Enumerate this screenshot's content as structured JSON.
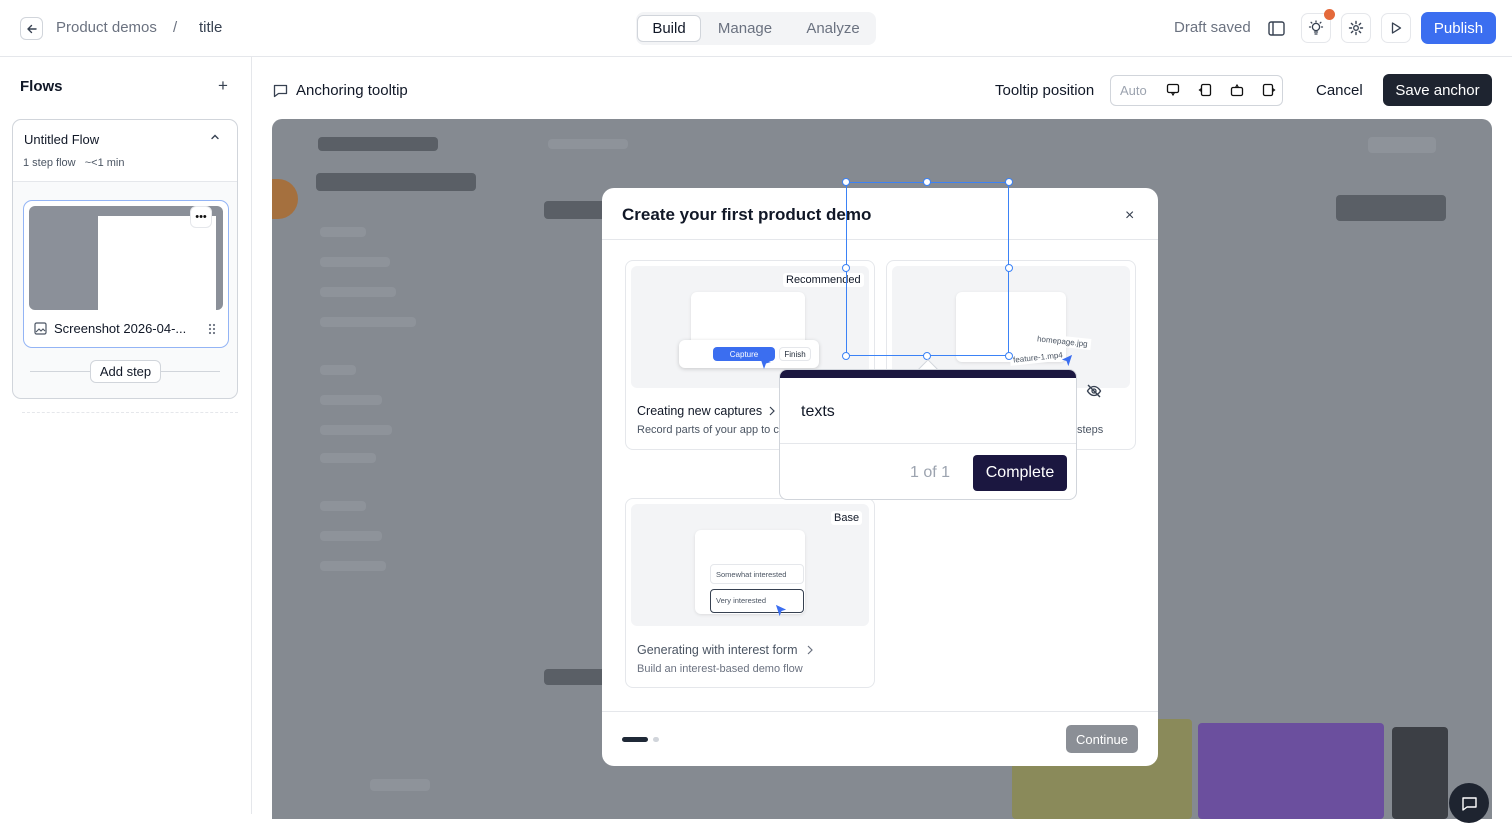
{
  "header": {
    "breadcrumb_parent": "Product demos",
    "breadcrumb_sep": "/",
    "breadcrumb_current": "title",
    "tabs": [
      {
        "label": "Build",
        "active": true
      },
      {
        "label": "Manage",
        "active": false
      },
      {
        "label": "Analyze",
        "active": false
      }
    ],
    "status": "Draft saved",
    "publish_label": "Publish",
    "icons": [
      "sidebar-toggle-icon",
      "lightbulb-icon",
      "gear-icon",
      "play-icon"
    ],
    "notification_dot_color": "#e4693a",
    "accent": "#3b6ef0"
  },
  "sidebar": {
    "title": "Flows",
    "add_label": "+",
    "flow": {
      "name": "Untitled Flow",
      "meta": "1 step flow   ~<1 min",
      "step_label": "Screenshot 2026-04-...",
      "more_label": "•••"
    },
    "add_step_label": "Add step"
  },
  "toolbar": {
    "mode_title": "Anchoring tooltip",
    "position_label": "Tooltip position",
    "position_auto": "Auto",
    "cancel_label": "Cancel",
    "save_label": "Save anchor"
  },
  "modal": {
    "title": "Create your first product demo",
    "close_label": "×",
    "options": [
      {
        "badge": "Recommended",
        "title": "Creating new captures",
        "desc": "Record parts of your app to cr",
        "capture_label": "Capture",
        "finish_label": "Finish"
      },
      {
        "desc_suffix": "steps",
        "file1": "homepage.jpg",
        "file2": "feature-1.mp4"
      },
      {
        "badge": "Base",
        "title": "Generating with interest form",
        "desc": "Build an interest-based demo flow",
        "choice1": "Somewhat interested",
        "choice2": "Very interested"
      }
    ],
    "continue_label": "Continue"
  },
  "tooltip": {
    "text": "texts",
    "count": "1 of 1",
    "complete_label": "Complete",
    "bar_color": "#1b1740"
  }
}
